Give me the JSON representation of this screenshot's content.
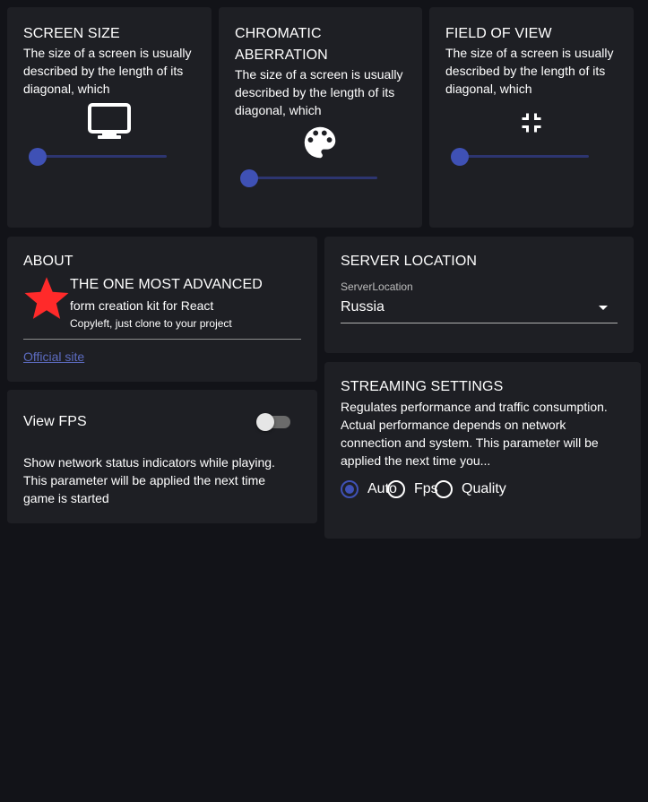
{
  "cards": {
    "screen_size": {
      "title": "SCREEN SIZE",
      "description": "The size of a screen is usually described by the length of its diagonal, which",
      "icon": "monitor-icon",
      "slider_value": 0
    },
    "chromatic": {
      "title_line1": "CHROMATIC",
      "title_line2": "ABERRATION",
      "description": "The size of a screen is usually described by the length of its diagonal, which",
      "icon": "palette-icon",
      "slider_value": 0
    },
    "fov": {
      "title": "FIELD OF VIEW",
      "description": "The size of a screen is usually described by the length of its diagonal, which",
      "icon": "fullscreen-exit-icon",
      "slider_value": 0
    }
  },
  "about": {
    "title": "ABOUT",
    "headline": "THE ONE MOST ADVANCED",
    "subline": "form creation kit for React",
    "note": "Copyleft, just clone to your project",
    "link": "Official site",
    "icon": "star-icon",
    "icon_color": "#ff2a2a"
  },
  "view_fps": {
    "title": "View FPS",
    "enabled": false,
    "description": "Show network status indicators while playing. This parameter will be applied the next time game is started"
  },
  "server_location": {
    "title": "SERVER LOCATION",
    "field_label": "ServerLocation",
    "value": "Russia"
  },
  "streaming": {
    "title": "STREAMING SETTINGS",
    "description": "Regulates performance and traffic consumption. Actual performance depends on network connection and system. This parameter will be applied the next time you...",
    "options": [
      "Auto",
      "Fps",
      "Quality"
    ],
    "selected": "Auto"
  },
  "colors": {
    "background": "#121318",
    "card": "#1e1f24",
    "accent": "#3f51b5",
    "link": "#5c6bc0"
  }
}
